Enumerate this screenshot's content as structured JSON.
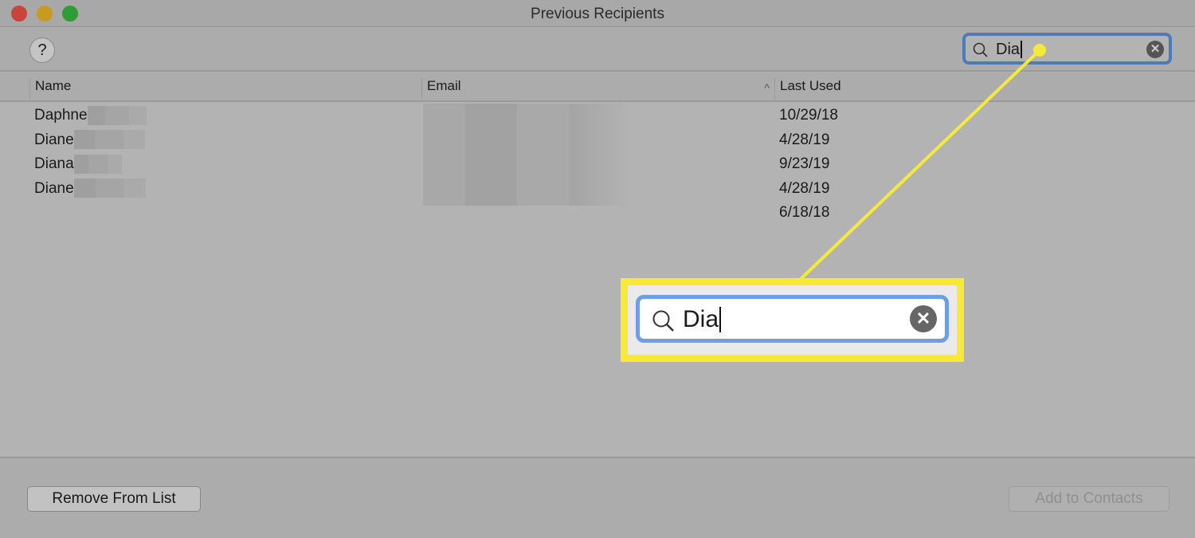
{
  "window": {
    "title": "Previous Recipients"
  },
  "toolbar": {
    "help_label": "?",
    "search": {
      "value": "Dia"
    }
  },
  "table": {
    "columns": [
      "Name",
      "Email",
      "Last Used"
    ],
    "sort_indicator": "^",
    "rows": [
      {
        "name": "Daphne",
        "last_used": "10/29/18"
      },
      {
        "name": "Diane",
        "last_used": "4/28/19"
      },
      {
        "name": "Diana",
        "last_used": "9/23/19"
      },
      {
        "name": "Diane",
        "last_used": "4/28/19"
      },
      {
        "name": "",
        "last_used": "6/18/18"
      }
    ]
  },
  "footer": {
    "remove_label": "Remove From List",
    "add_label": "Add to Contacts"
  },
  "callout": {
    "search_value": "Dia",
    "color": "#f5e93a"
  }
}
